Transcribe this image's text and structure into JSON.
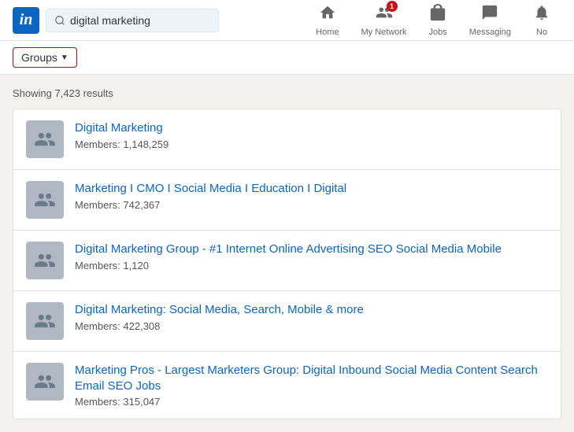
{
  "navbar": {
    "logo_text": "in",
    "search_value": "digital marketing",
    "search_placeholder": "digital marketing",
    "nav_items": [
      {
        "id": "home",
        "label": "Home",
        "icon": "home"
      },
      {
        "id": "my-network",
        "label": "My Network",
        "icon": "network",
        "badge": "1"
      },
      {
        "id": "jobs",
        "label": "Jobs",
        "icon": "jobs"
      },
      {
        "id": "messaging",
        "label": "Messaging",
        "icon": "messaging"
      },
      {
        "id": "notifications",
        "label": "No",
        "icon": "notifications"
      }
    ]
  },
  "filter": {
    "label": "Groups",
    "arrow": "▼"
  },
  "results": {
    "count_text": "Showing 7,423 results",
    "items": [
      {
        "title": "Digital Marketing",
        "members_label": "Members: 1,148,259"
      },
      {
        "title": "Marketing I CMO I Social Media I Education I Digital",
        "members_label": "Members: 742,367"
      },
      {
        "title": "Digital Marketing Group - #1 Internet Online Advertising SEO Social Media Mobile",
        "members_label": "Members: 1,120"
      },
      {
        "title": "Digital Marketing: Social Media, Search, Mobile & more",
        "members_label": "Members: 422,308"
      },
      {
        "title": "Marketing Pros - Largest Marketers Group: Digital Inbound Social Media Content Search Email SEO Jobs",
        "members_label": "Members: 315,047"
      }
    ]
  },
  "colors": {
    "linkedin_blue": "#0a66c2",
    "border_red": "#cc0000",
    "avatar_bg": "#b0b8c4",
    "navbar_bg": "#ffffff"
  }
}
